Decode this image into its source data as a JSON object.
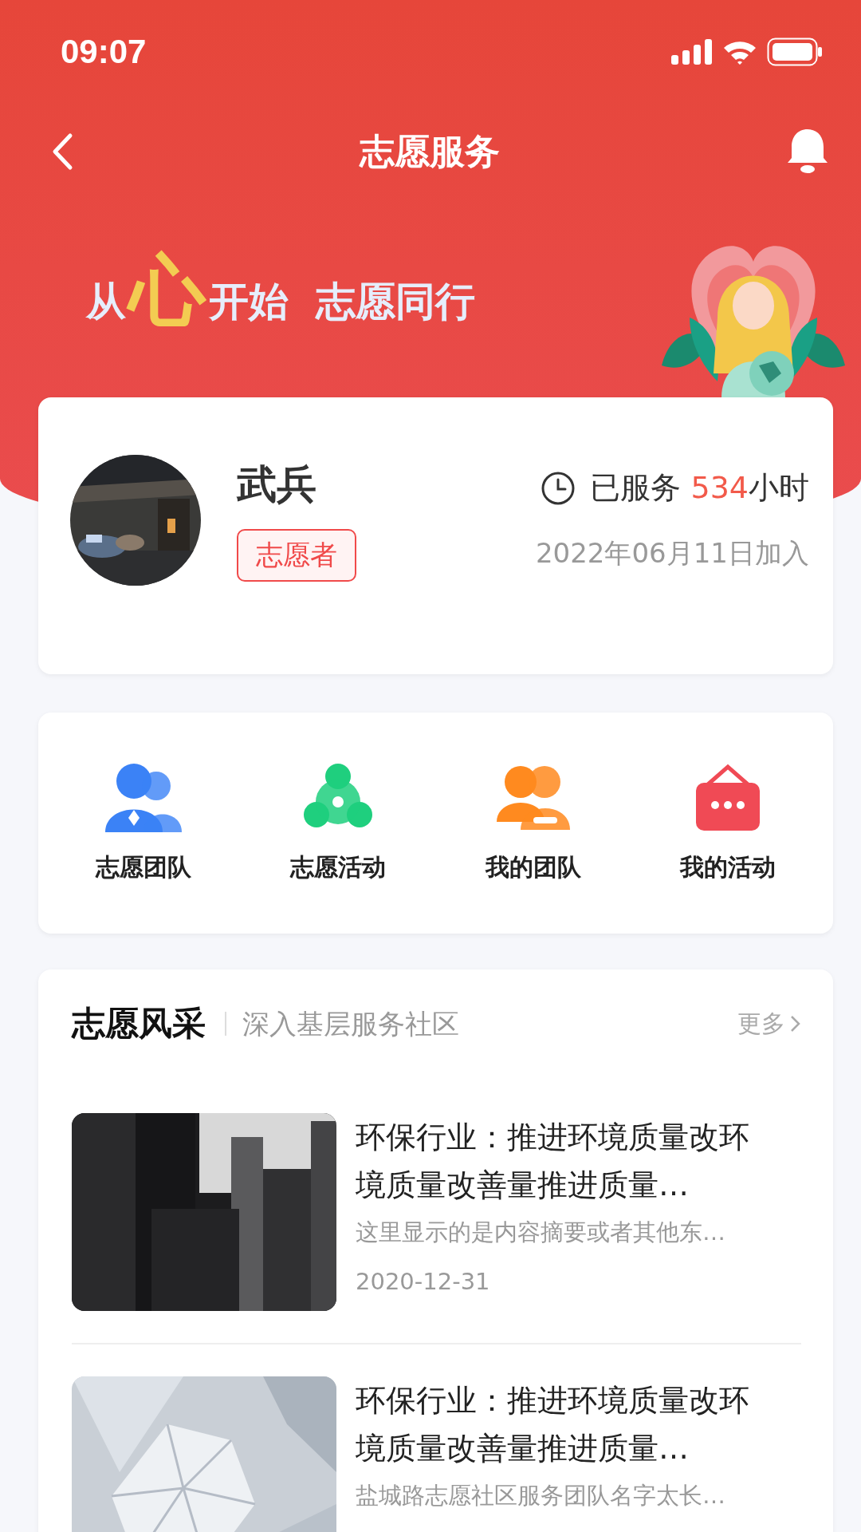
{
  "status_bar": {
    "time": "09:07"
  },
  "nav": {
    "title": "志愿服务"
  },
  "banner": {
    "slogan": [
      {
        "text": "从",
        "kind": "plain"
      },
      {
        "text": "心",
        "kind": "accent"
      },
      {
        "text": "开始",
        "kind": "plain"
      },
      {
        "text": "志愿同行",
        "kind": "gap"
      }
    ]
  },
  "profile": {
    "name": "武兵",
    "tag": "志愿者",
    "hours": {
      "prefix": "已服务",
      "value": "534",
      "suffix": "小时"
    },
    "joined": "2022年06月11日加入"
  },
  "shortcuts": [
    {
      "label": "志愿团队",
      "kind": "team",
      "color": "#3b82f6"
    },
    {
      "label": "志愿活动",
      "kind": "activity",
      "color": "#1fcf7e"
    },
    {
      "label": "我的团队",
      "kind": "myteam",
      "color": "#ff8a1f"
    },
    {
      "label": "我的活动",
      "kind": "myactivity",
      "color": "#f04a55"
    }
  ],
  "section": {
    "title": "志愿风采",
    "subtitle": "深入基层服务社区",
    "more": "更多",
    "articles": [
      {
        "title": "环保行业：推进环境质量改环境质量改善量推进质量…",
        "summary": "这里显示的是内容摘要或者其他东…",
        "date": "2020-12-31",
        "kind": "city"
      },
      {
        "title": "环保行业：推进环境质量改环境质量改善量推进质量…",
        "summary": "盐城路志愿社区服务团队名字太长…",
        "kind": "crystal"
      }
    ]
  }
}
